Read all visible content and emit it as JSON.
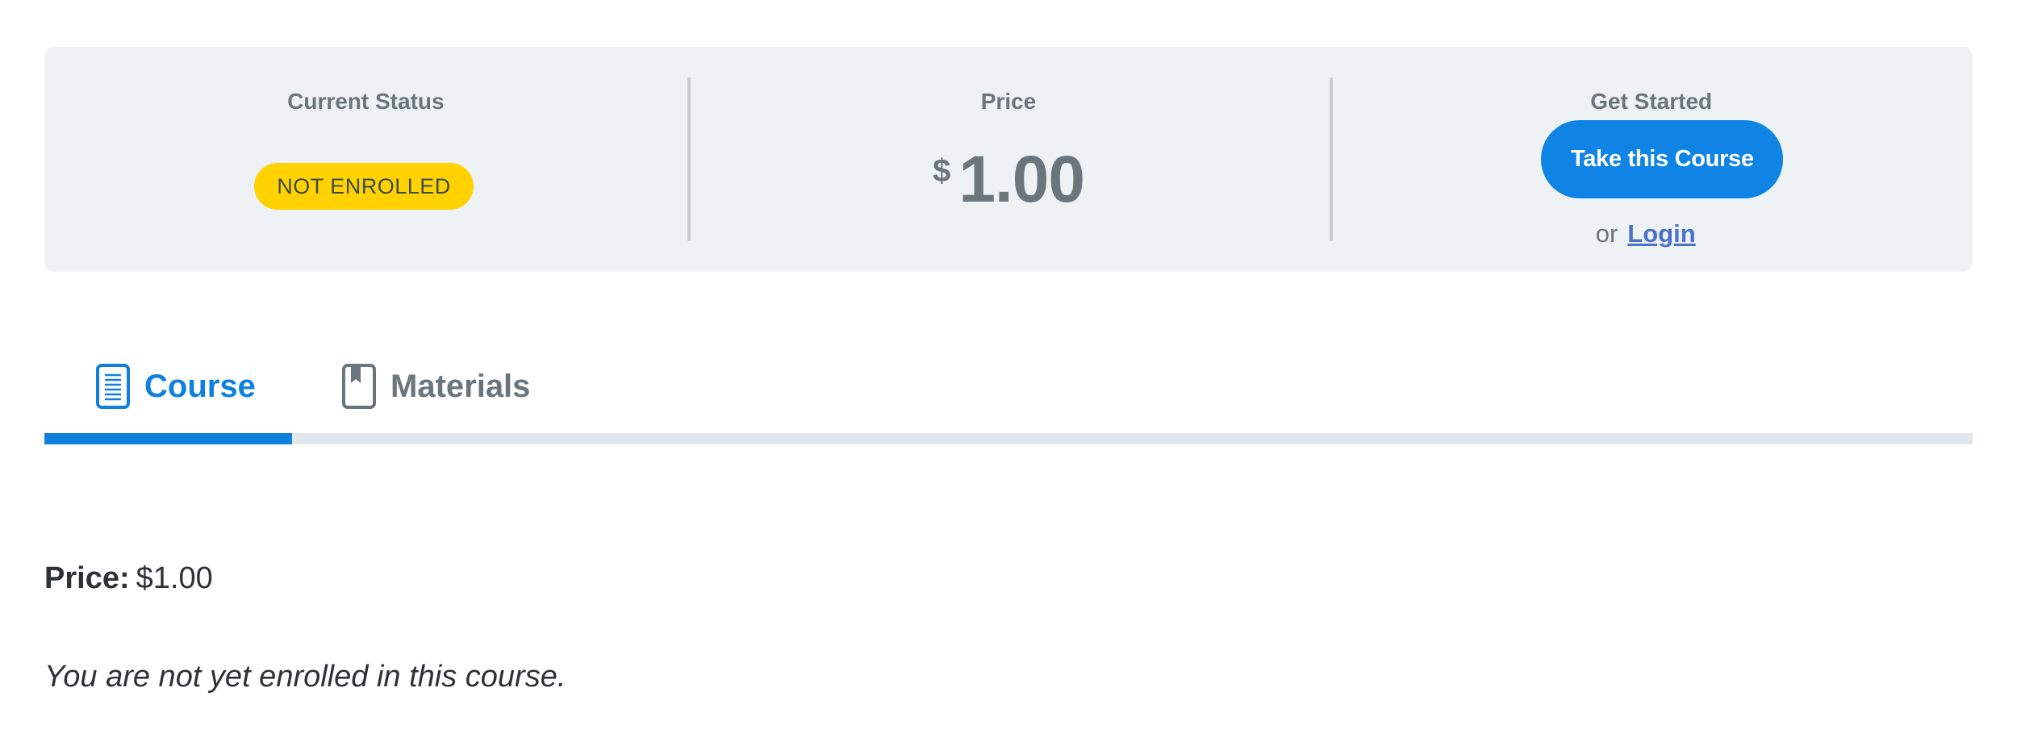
{
  "status_bar": {
    "status": {
      "heading": "Current Status",
      "badge": "NOT ENROLLED",
      "badge_color": "#ffd200"
    },
    "price": {
      "heading": "Price",
      "currency": "$",
      "amount": "1.00"
    },
    "get_started": {
      "heading": "Get Started",
      "button_label": "Take this Course",
      "button_color": "#0f84e4",
      "or_text": "or",
      "login_label": "Login"
    }
  },
  "tabs": {
    "items": [
      {
        "label": "Course",
        "icon": "document-icon",
        "active": true
      },
      {
        "label": "Materials",
        "icon": "bookmark-book-icon",
        "active": false
      }
    ],
    "accent_color": "#1080de"
  },
  "content": {
    "price_label": "Price:",
    "price_value": "$1.00",
    "notice": "You are not yet enrolled in this course."
  }
}
